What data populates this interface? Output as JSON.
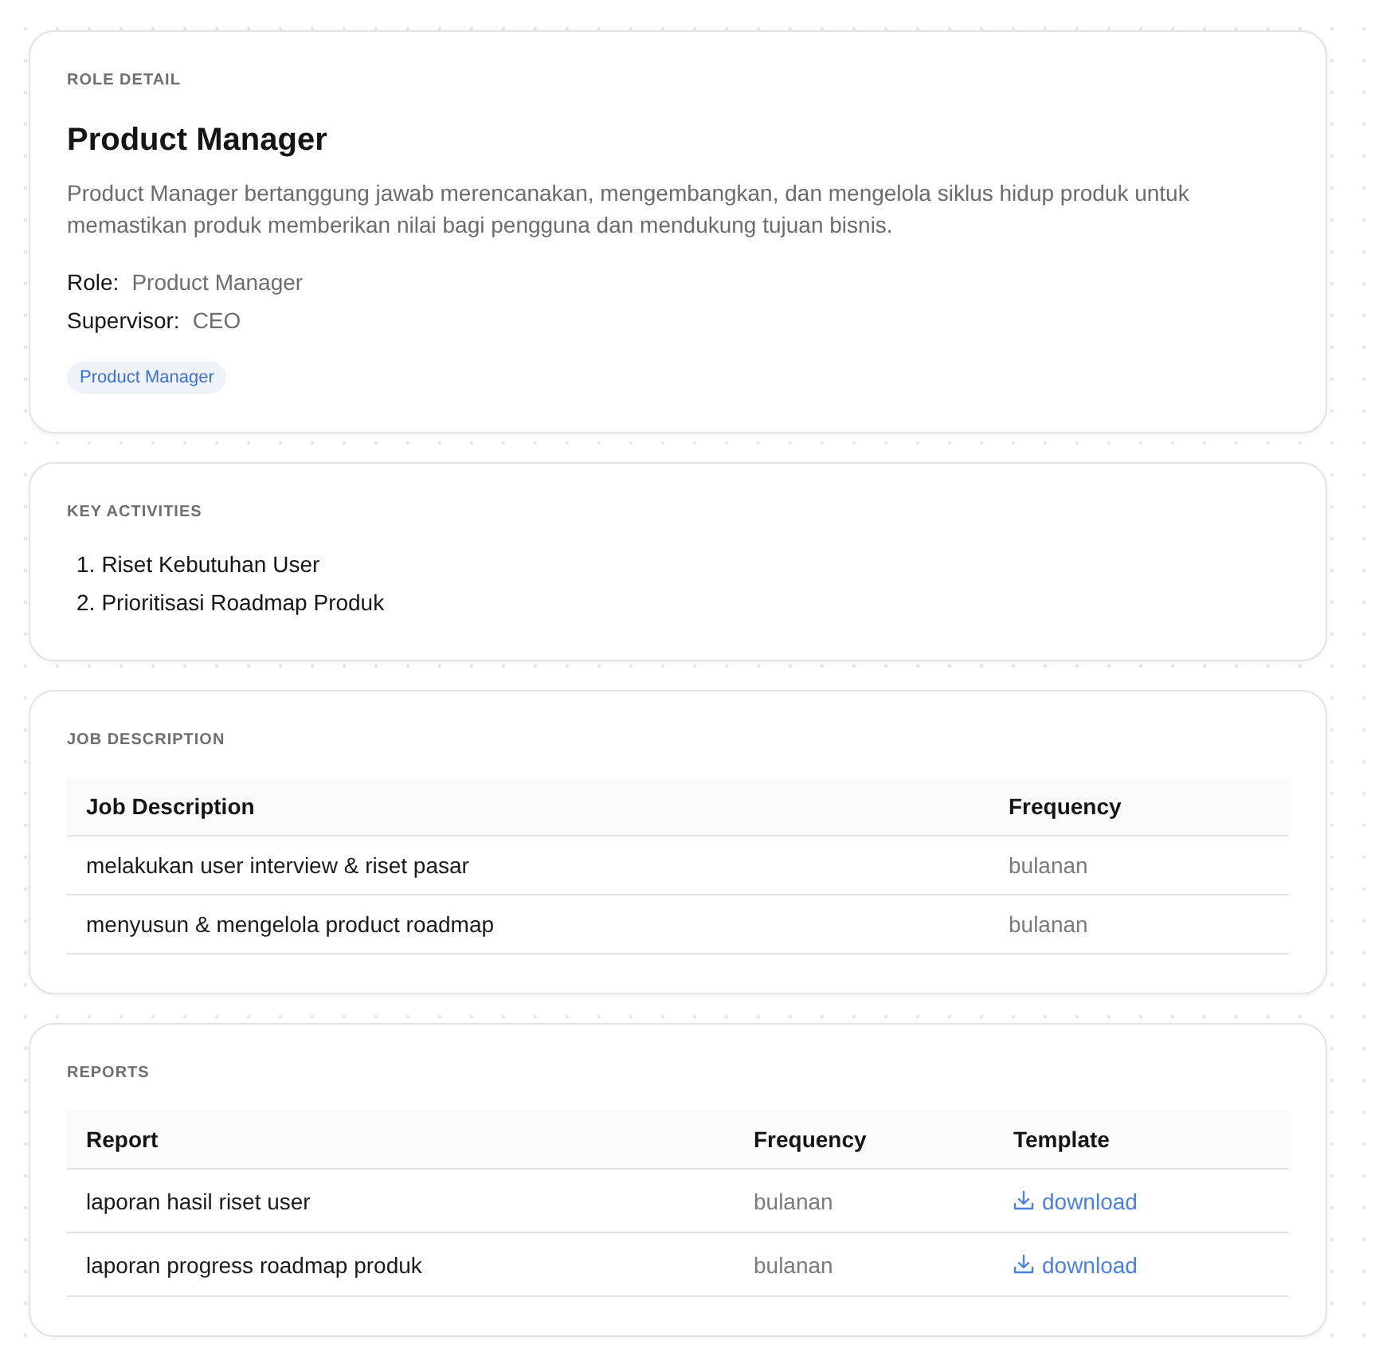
{
  "role_detail": {
    "label": "ROLE DETAIL",
    "title": "Product Manager",
    "description": "Product Manager bertanggung jawab merencanakan, mengembangkan, dan mengelola siklus hidup produk untuk memastikan produk memberikan nilai bagi pengguna dan mendukung tujuan bisnis.",
    "fields": [
      {
        "label": "Role:",
        "value": "Product Manager"
      },
      {
        "label": "Supervisor:",
        "value": "CEO"
      }
    ],
    "tags": [
      "Product Manager"
    ]
  },
  "key_activities": {
    "label": "KEY ACTIVITIES",
    "items": [
      {
        "number": "1.",
        "text": "Riset Kebutuhan User"
      },
      {
        "number": "2.",
        "text": "Prioritisasi Roadmap Produk"
      }
    ]
  },
  "job_description": {
    "label": "JOB DESCRIPTION",
    "columns": [
      "Job Description",
      "Frequency"
    ],
    "rows": [
      {
        "description": "melakukan user interview & riset pasar",
        "frequency": "bulanan"
      },
      {
        "description": "menyusun & mengelola product roadmap",
        "frequency": "bulanan"
      }
    ]
  },
  "reports": {
    "label": "REPORTS",
    "columns": [
      "Report",
      "Frequency",
      "Template"
    ],
    "rows": [
      {
        "report": "laporan hasil riset user",
        "frequency": "bulanan",
        "template": "download"
      },
      {
        "report": "laporan progress roadmap produk",
        "frequency": "bulanan",
        "template": "download"
      }
    ]
  }
}
